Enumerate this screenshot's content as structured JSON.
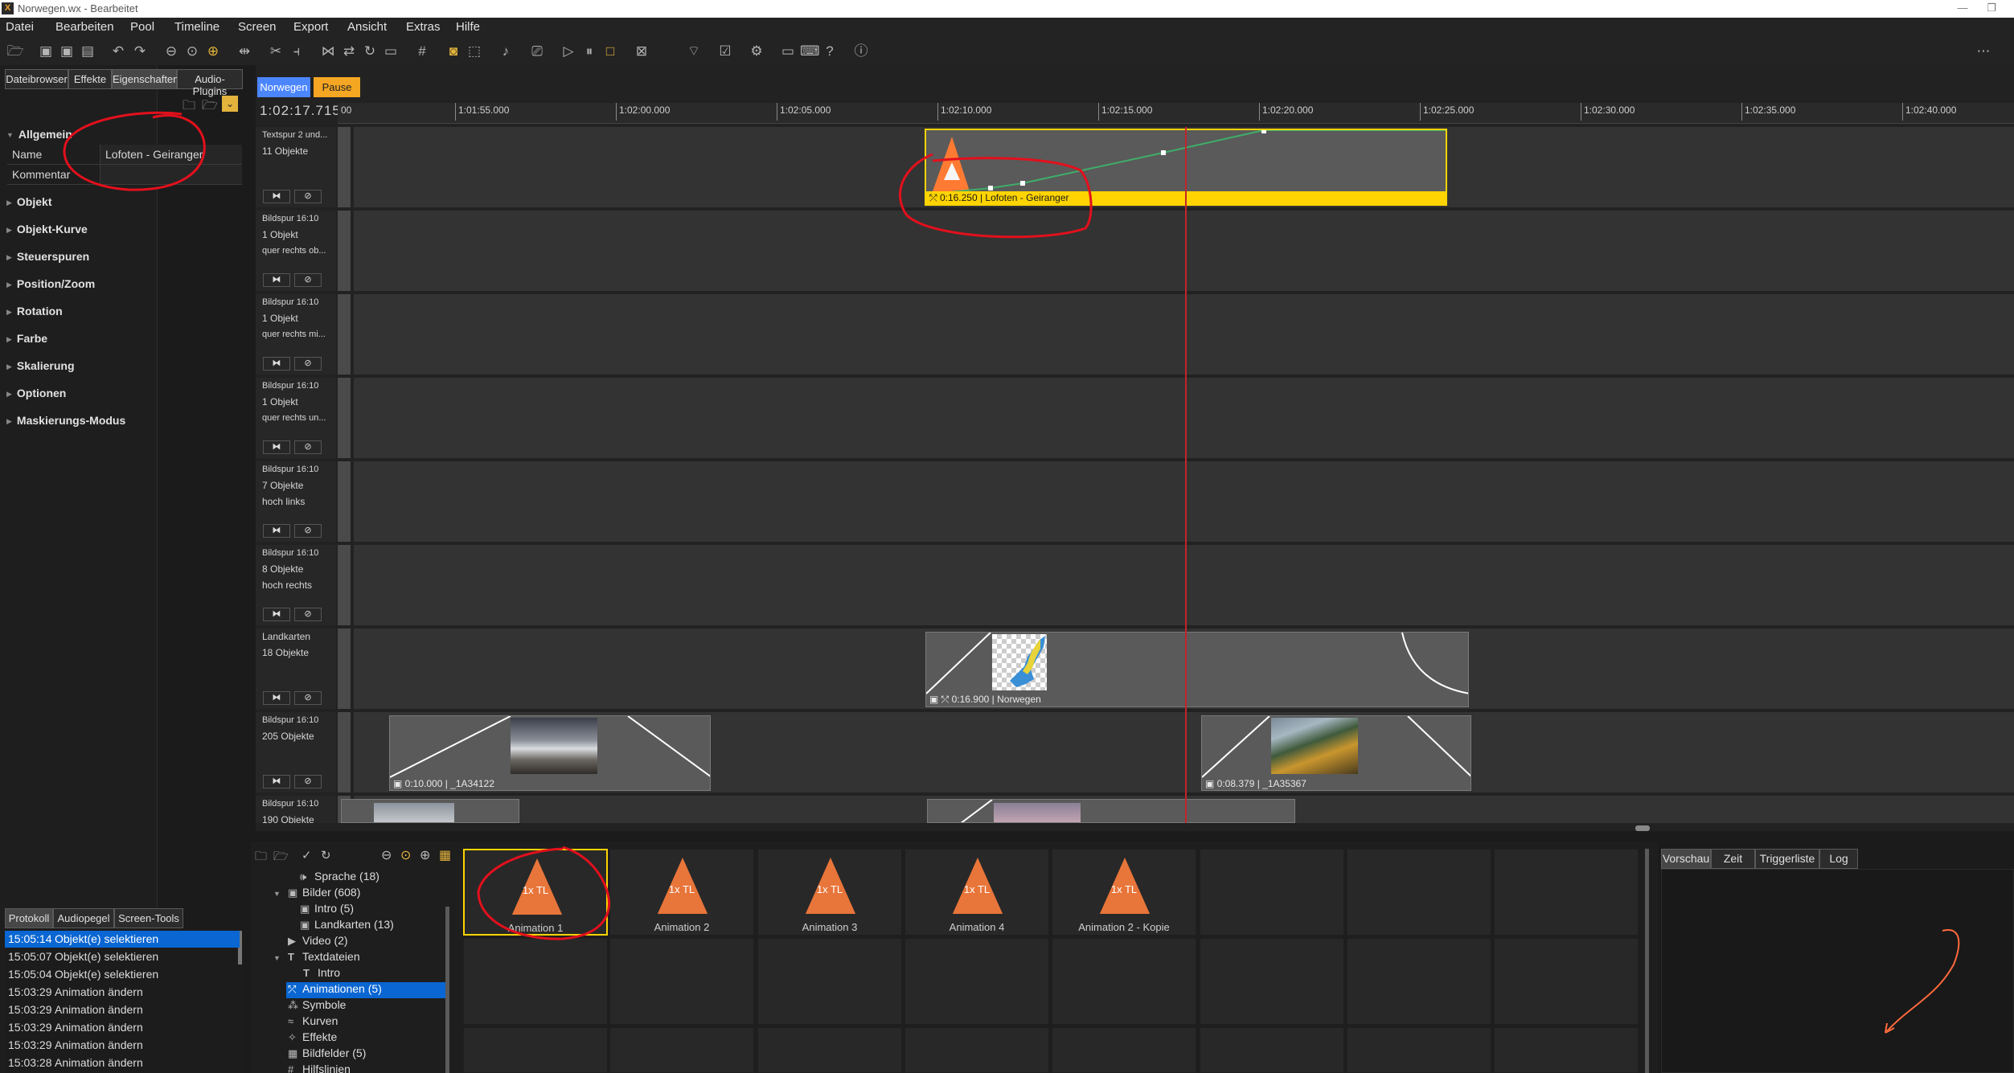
{
  "window": {
    "title": "Norwegen.wx - Bearbeitet",
    "logo": "X"
  },
  "menu": [
    "Datei",
    "Bearbeiten",
    "Pool",
    "Timeline",
    "Screen",
    "Export",
    "Ansicht",
    "Extras",
    "Hilfe"
  ],
  "toolbar_icons": [
    "open-folder",
    "save",
    "save-as",
    "save-all",
    "undo",
    "redo",
    "zoom-out",
    "zoom-reset",
    "zoom-in",
    "fit",
    "cut",
    "split",
    "trim",
    "move",
    "rotate",
    "ruler",
    "grid",
    "snap",
    "marker",
    "audio",
    "export-video",
    "play",
    "pause",
    "stop",
    "close-box",
    "wifi",
    "checklist",
    "settings",
    "chat",
    "keyboard",
    "help",
    "info"
  ],
  "left_tabs": [
    "Dateibrowser",
    "Effekte",
    "Eigenschaften",
    "Audio-Plugins"
  ],
  "props": {
    "section": "Allgemein",
    "name_label": "Name",
    "name_value": "Lofoten - Geiranger",
    "comment_label": "Kommentar",
    "groups": [
      "Objekt",
      "Objekt-Kurve",
      "Steuerspuren",
      "Position/Zoom",
      "Rotation",
      "Farbe",
      "Skalierung",
      "Optionen",
      "Maskierungs-Modus"
    ]
  },
  "bottom_tabs": [
    "Protokoll",
    "Audiopegel",
    "Screen-Tools"
  ],
  "log": [
    {
      "t": "15:05:14",
      "a": "Objekt(e) selektieren"
    },
    {
      "t": "15:05:07",
      "a": "Objekt(e) selektieren"
    },
    {
      "t": "15:05:04",
      "a": "Objekt(e) selektieren"
    },
    {
      "t": "15:03:29",
      "a": "Animation ändern"
    },
    {
      "t": "15:03:29",
      "a": "Animation ändern"
    },
    {
      "t": "15:03:29",
      "a": "Animation ändern"
    },
    {
      "t": "15:03:29",
      "a": "Animation ändern"
    },
    {
      "t": "15:03:28",
      "a": "Animation ändern"
    }
  ],
  "timeline": {
    "tabs": [
      "Norwegen",
      "Pause"
    ],
    "current_time": "1:02:17.715",
    "ruler": [
      "00",
      "1:01:55.000",
      "1:02:00.000",
      "1:02:05.000",
      "1:02:10.000",
      "1:02:15.000",
      "1:02:20.000",
      "1:02:25.000",
      "1:02:30.000",
      "1:02:35.000",
      "1:02:40.000"
    ],
    "tracks": [
      {
        "l1": "Textspur 2 und...",
        "l2": "11 Objekte",
        "l3": ""
      },
      {
        "l1": "Bildspur 16:10",
        "l2": "1 Objekt",
        "l3": "quer rechts ob..."
      },
      {
        "l1": "Bildspur 16:10",
        "l2": "1 Objekt",
        "l3": "quer rechts mi..."
      },
      {
        "l1": "Bildspur 16:10",
        "l2": "1 Objekt",
        "l3": "quer rechts un..."
      },
      {
        "l1": "Bildspur 16:10",
        "l2": "7 Objekte",
        "l3": "hoch links"
      },
      {
        "l1": "Bildspur 16:10",
        "l2": "8 Objekte",
        "l3": "hoch rechts"
      },
      {
        "l1": "Landkarten",
        "l2": "18 Objekte",
        "l3": ""
      },
      {
        "l1": "Bildspur 16:10",
        "l2": "205 Objekte",
        "l3": ""
      },
      {
        "l1": "Bildspur 16:10",
        "l2": "190 Objekte",
        "l3": ""
      }
    ],
    "clips": {
      "anim": "0:16.250  |  Lofoten - Geiranger",
      "map": "0:16.900  |  Norwegen",
      "img1": "0:10.000  |  _1A34122",
      "img2": "0:08.379  |  _1A35367"
    },
    "track_btn_play": "⧓",
    "track_btn_off": "⊘"
  },
  "pool": {
    "tree": [
      {
        "label": "Sprache (18)",
        "icon": "speaker-icon",
        "indent": 2
      },
      {
        "label": "Bilder (608)",
        "icon": "image-icon",
        "indent": 1,
        "open": true
      },
      {
        "label": "Intro (5)",
        "icon": "image-icon",
        "indent": 2
      },
      {
        "label": "Landkarten (13)",
        "icon": "image-icon",
        "indent": 2
      },
      {
        "label": "Video (2)",
        "icon": "video-icon",
        "indent": 1
      },
      {
        "label": "Textdateien",
        "icon": "text-icon",
        "indent": 1,
        "open": true
      },
      {
        "label": "Intro",
        "icon": "text-icon",
        "indent": 2
      },
      {
        "label": "Animationen (5)",
        "icon": "animation-icon",
        "indent": 1,
        "selected": true
      },
      {
        "label": "Symbole",
        "icon": "symbol-icon",
        "indent": 1
      },
      {
        "label": "Kurven",
        "icon": "curve-icon",
        "indent": 1
      },
      {
        "label": "Effekte",
        "icon": "effect-icon",
        "indent": 1
      },
      {
        "label": "Bildfelder (5)",
        "icon": "grid-icon",
        "indent": 1
      },
      {
        "label": "Hilfslinien",
        "icon": "guides-icon",
        "indent": 1
      }
    ],
    "tiles": [
      {
        "label": "Animation 1",
        "badge": "1x TL"
      },
      {
        "label": "Animation 2",
        "badge": "1x TL"
      },
      {
        "label": "Animation 3",
        "badge": "1x TL"
      },
      {
        "label": "Animation 4",
        "badge": "1x TL"
      },
      {
        "label": "Animation 2 - Kopie",
        "badge": "1x TL"
      }
    ]
  },
  "preview_tabs": [
    "Vorschau",
    "Zeit",
    "Triggerliste",
    "Log"
  ],
  "colors": {
    "accent_blue": "#0a66d2",
    "tab_norwegen": "#4c86ff",
    "tab_pause": "#f5a623",
    "clip_yellow": "#ffd400",
    "anim_orange": "#ff7a33",
    "annotation_red": "#e3101c",
    "playhead": "#c4242a",
    "curve_green": "#3fae6a"
  }
}
